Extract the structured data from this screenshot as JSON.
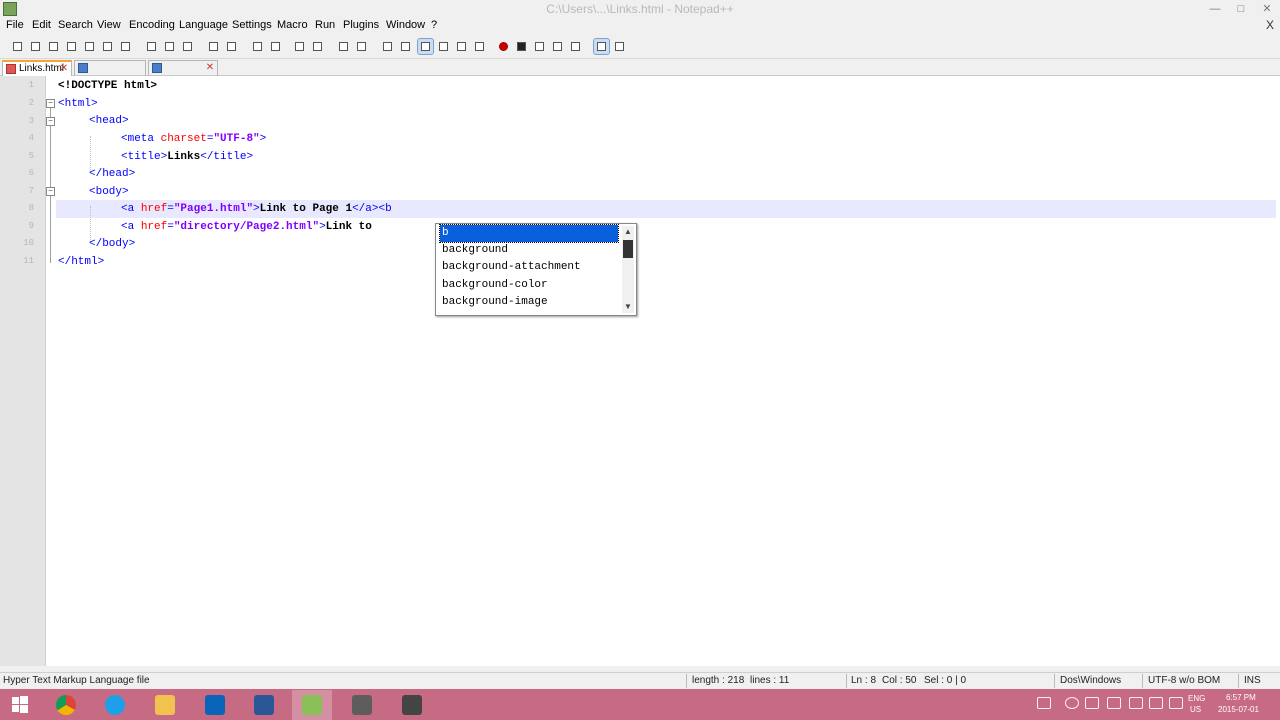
{
  "window": {
    "title": "C:\\Users\\...\\Links.html - Notepad++"
  },
  "menubar": {
    "items": [
      "File",
      "Edit",
      "Search",
      "View",
      "Encoding",
      "Language",
      "Settings",
      "Macro",
      "Run",
      "Plugins",
      "Window",
      "?"
    ],
    "close_label": "X"
  },
  "tabs": [
    {
      "label": "Links.html",
      "active": true
    },
    {
      "label": "",
      "active": false
    },
    {
      "label": "",
      "active": false
    }
  ],
  "editor": {
    "line_numbers": [
      "1",
      "2",
      "3",
      "4",
      "5",
      "6",
      "7",
      "8",
      "9",
      "10",
      "11"
    ],
    "lines": [
      {
        "segments": [
          {
            "cls": "tx",
            "text": "<!DOCTYPE html>"
          }
        ]
      },
      {
        "segments": [
          {
            "cls": "t",
            "text": "<html>"
          }
        ]
      },
      {
        "segments": [
          {
            "cls": "t",
            "text": "<head>"
          }
        ]
      },
      {
        "segments": [
          {
            "cls": "t",
            "text": "<meta "
          },
          {
            "cls": "a",
            "text": "charset"
          },
          {
            "cls": "t",
            "text": "="
          },
          {
            "cls": "v",
            "text": "\"UTF-8\""
          },
          {
            "cls": "t",
            "text": ">"
          }
        ]
      },
      {
        "segments": [
          {
            "cls": "t",
            "text": "<title>"
          },
          {
            "cls": "tx",
            "text": "Links"
          },
          {
            "cls": "t",
            "text": "</title>"
          }
        ]
      },
      {
        "segments": [
          {
            "cls": "t",
            "text": "</head>"
          }
        ]
      },
      {
        "segments": [
          {
            "cls": "t",
            "text": "<body>"
          }
        ]
      },
      {
        "segments": [
          {
            "cls": "t",
            "text": "<a "
          },
          {
            "cls": "a",
            "text": "href"
          },
          {
            "cls": "t",
            "text": "="
          },
          {
            "cls": "v",
            "text": "\"Page1.html\""
          },
          {
            "cls": "t",
            "text": ">"
          },
          {
            "cls": "tx",
            "text": "Link to Page 1"
          },
          {
            "cls": "t",
            "text": "</a><b"
          }
        ]
      },
      {
        "segments": [
          {
            "cls": "t",
            "text": "<a "
          },
          {
            "cls": "a",
            "text": "href"
          },
          {
            "cls": "t",
            "text": "="
          },
          {
            "cls": "v",
            "text": "\"directory/Page2.html\""
          },
          {
            "cls": "t",
            "text": ">"
          },
          {
            "cls": "tx",
            "text": "Link to "
          }
        ]
      },
      {
        "segments": [
          {
            "cls": "t",
            "text": "</body>"
          }
        ]
      },
      {
        "segments": [
          {
            "cls": "t",
            "text": "</html>"
          }
        ]
      }
    ]
  },
  "autocomplete": {
    "items": [
      "b",
      "background",
      "background-attachment",
      "background-color",
      "background-image"
    ],
    "selected_index": 0
  },
  "statusbar": {
    "file_type": "Hyper Text Markup Language file",
    "length": "length : 218",
    "lines": "lines : 11",
    "ln": "Ln : 8",
    "col": "Col : 50",
    "sel": "Sel : 0 | 0",
    "eol": "Dos\\Windows",
    "encoding": "UTF-8 w/o BOM",
    "ins": "INS"
  },
  "taskbar": {
    "apps": [
      "windows-start",
      "chrome",
      "internet-explorer",
      "file-explorer",
      "outlook",
      "word",
      "notepad-plus-plus",
      "app-7",
      "app-8"
    ],
    "lang": "ENG",
    "region": "US",
    "time": "6:57 PM",
    "date": "2015-07-01"
  },
  "colors": {
    "accent_tab": "#f7a33a",
    "taskbar": "#c76a83",
    "ac_selected": "#0a5fdc"
  }
}
